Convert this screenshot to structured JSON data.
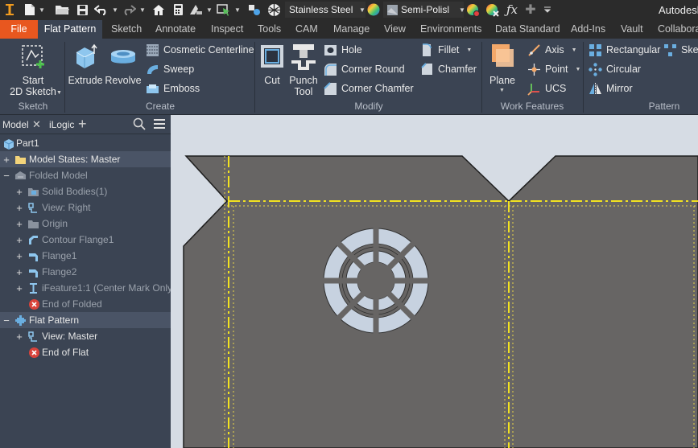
{
  "app_title": "Autodesk",
  "quick_access": {
    "material": "Stainless Steel",
    "appearance": "Semi-Polisl"
  },
  "ribbon_tabs": [
    "File",
    "Flat Pattern",
    "Sketch",
    "Annotate",
    "Inspect",
    "Tools",
    "CAM",
    "Manage",
    "View",
    "Environments",
    "Data Standard",
    "Add-Ins",
    "Vault",
    "Collabora"
  ],
  "panels": {
    "sketch": {
      "label": "Sketch",
      "start_line1": "Start",
      "start_line2": "2D Sketch"
    },
    "create": {
      "label": "Create",
      "extrude": "Extrude",
      "revolve": "Revolve",
      "cosmetic_centerline": "Cosmetic Centerline",
      "sweep": "Sweep",
      "emboss": "Emboss"
    },
    "modify": {
      "label": "Modify",
      "cut": "Cut",
      "punch_line1": "Punch",
      "punch_line2": "Tool",
      "hole": "Hole",
      "corner_round": "Corner Round",
      "corner_chamfer": "Corner Chamfer",
      "fillet": "Fillet",
      "chamfer": "Chamfer"
    },
    "work_features": {
      "label": "Work Features",
      "plane": "Plane",
      "axis": "Axis",
      "point": "Point",
      "ucs": "UCS"
    },
    "pattern": {
      "label": "Pattern",
      "rectangular": "Rectangular",
      "circular": "Circular",
      "mirror": "Mirror",
      "sketch_trunc": "Sket"
    }
  },
  "browser": {
    "tab_model": "Model",
    "tab_ilogic": "iLogic",
    "tree": [
      "Part1",
      "Model States: Master",
      "Folded Model",
      "Solid Bodies(1)",
      "View: Right",
      "Origin",
      "Contour Flange1",
      "Flange1",
      "Flange2",
      "iFeature1:1 (Center Mark Only)",
      "End of Folded",
      "Flat Pattern",
      "View: Master",
      "End of Flat"
    ]
  },
  "colors": {
    "file_tab": "#e8571f",
    "ribbon_bg": "#3b4453",
    "title_bar": "#2b2b2b",
    "viewport_bg": "#d6dce4",
    "sheet_fill": "#676564",
    "bend_line": "#f2e21f"
  }
}
